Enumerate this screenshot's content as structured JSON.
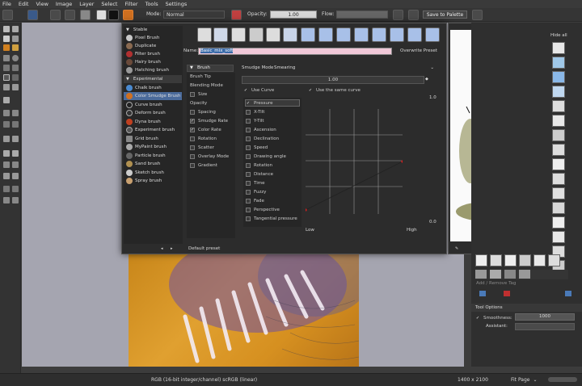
{
  "menu": [
    "File",
    "Edit",
    "View",
    "Image",
    "Layer",
    "Select",
    "Filter",
    "Tools",
    "Settings"
  ],
  "toolbar": {
    "mode_label": "Mode:",
    "mode_value": "Normal",
    "opacity_label": "Opacity:",
    "opacity_value": "1.00",
    "flow_label": "Flow:",
    "save_palette": "Save to Palette"
  },
  "editor": {
    "tree": [
      {
        "label": "Stable",
        "header": true
      },
      {
        "label": "Pixel Brush",
        "color": "#c8c8c8"
      },
      {
        "label": "Duplicate",
        "color": "#8a6a50"
      },
      {
        "label": "Filter brush",
        "color": "#b03030"
      },
      {
        "label": "Hairy brush",
        "color": "#6a4a3a"
      },
      {
        "label": "Hatching brush",
        "color": "#999"
      },
      {
        "label": "Experimental",
        "header": true
      },
      {
        "label": "Chalk brush",
        "color": "#4a8ad0"
      },
      {
        "label": "Color Smudge Brush",
        "color": "#d07020",
        "selected": true
      },
      {
        "label": "Curve brush",
        "color": "#222"
      },
      {
        "label": "Deform brush",
        "color": "#333"
      },
      {
        "label": "Dyna brush",
        "color": "#c04020"
      },
      {
        "label": "Experiment brush",
        "color": "#555"
      },
      {
        "label": "Grid brush",
        "color": "#888"
      },
      {
        "label": "MyPaint brush",
        "color": "#aaa"
      },
      {
        "label": "Particle brush",
        "color": "#666"
      },
      {
        "label": "Sand brush",
        "color": "#b09050"
      },
      {
        "label": "Sketch brush",
        "color": "#ccc"
      },
      {
        "label": "Spray brush",
        "color": "#c8a070"
      }
    ],
    "name_label": "Name:",
    "name_value": "Basic_mix_soft",
    "overwrite": "Overwrite Preset",
    "brush_header": "Brush",
    "props": [
      "Brush Tip",
      "Blending Mode",
      "Size",
      "Opacity",
      "Spacing",
      "Smudge Rate",
      "Color Rate",
      "Rotation",
      "Scatter",
      "Overlay Mode",
      "Gradient"
    ],
    "smudge_mode_label": "Smudge Mode",
    "smudge_mode_value": "Smearing",
    "strength_value": "1.00",
    "use_curve": "Use Curve",
    "use_same_curve": "Use the same curve",
    "sensors": [
      "Pressure",
      "X-Tilt",
      "Y-Tilt",
      "Ascension",
      "Declination",
      "Speed",
      "Drawing angle",
      "Rotation",
      "Distance",
      "Time",
      "Fuzzy",
      "Fade",
      "Perspective",
      "Tangential pressure"
    ],
    "curve_top": "1.0",
    "curve_bottom": "0.0",
    "curve_low": "Low",
    "curve_high": "High",
    "default_preset": "Default preset"
  },
  "dock": {
    "hide_all": "Hide all",
    "add_remove_tag": "Add / Remove Tag",
    "tool_options": "Tool Options",
    "smoothness_label": "Smoothness:",
    "smoothness_value": "1000",
    "assistant_label": "Assistant:"
  },
  "status": {
    "colorspace": "RGB (16-bit integer/channel)  scRGB (linear)",
    "size": "1400 x 2100",
    "fit": "Fit Page"
  }
}
